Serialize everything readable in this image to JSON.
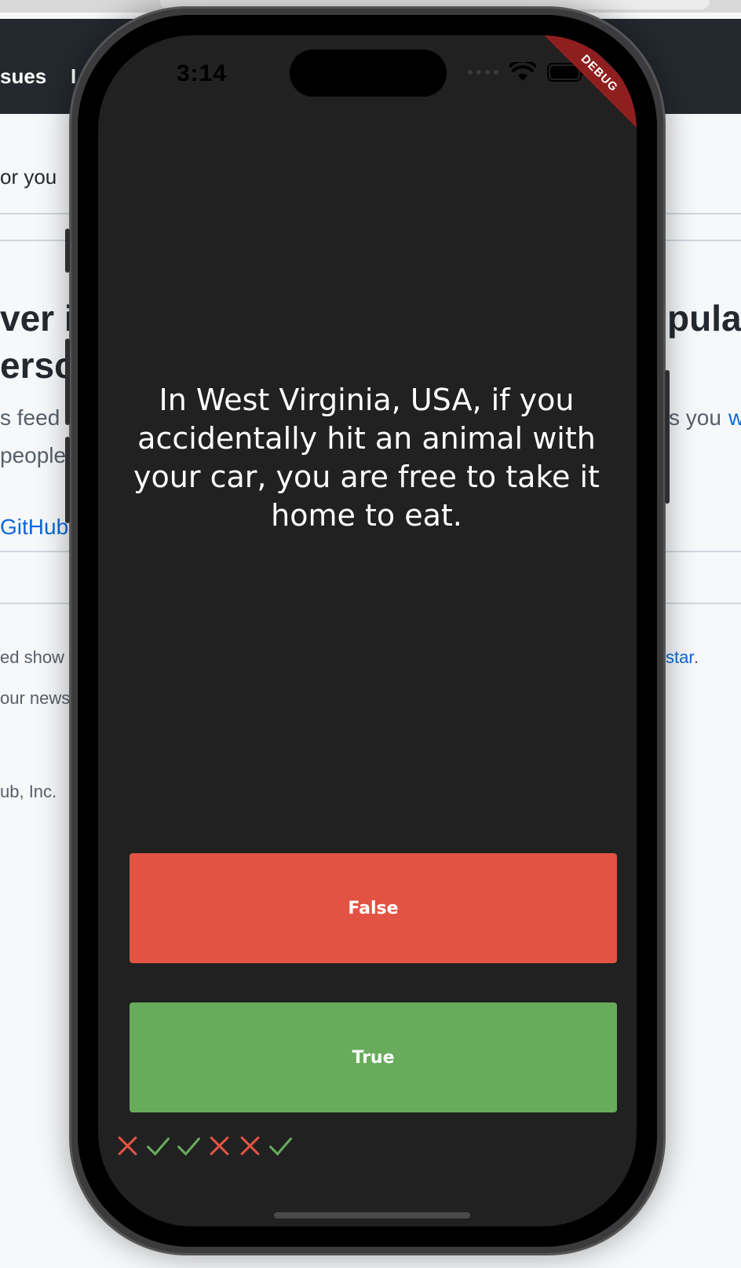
{
  "background_page": {
    "nav": [
      "sues",
      "I"
    ],
    "text_lines": [
      "or you",
      "ver ir",
      "ersc",
      "s feed",
      "people",
      "GitHub",
      "ed show",
      "our news",
      "ub, Inc.",
      "pula",
      "s you",
      "w",
      "star",
      "."
    ]
  },
  "status_bar": {
    "time": "3:14",
    "icons": [
      "signal-dots-icon",
      "wifi-icon",
      "battery-icon"
    ]
  },
  "debug_banner": "DEBUG",
  "quiz": {
    "question": "In West Virginia, USA, if you accidentally hit an animal with your car, you are free to take it home to eat.",
    "false_label": "False",
    "true_label": "True",
    "score_marks": [
      "wrong",
      "correct",
      "correct",
      "wrong",
      "wrong",
      "correct"
    ]
  },
  "colors": {
    "false_button": "#e25343",
    "true_button": "#67ab5b",
    "screen_bg": "#212121",
    "wrong_mark": "#e25343",
    "correct_mark": "#67ab5b"
  }
}
